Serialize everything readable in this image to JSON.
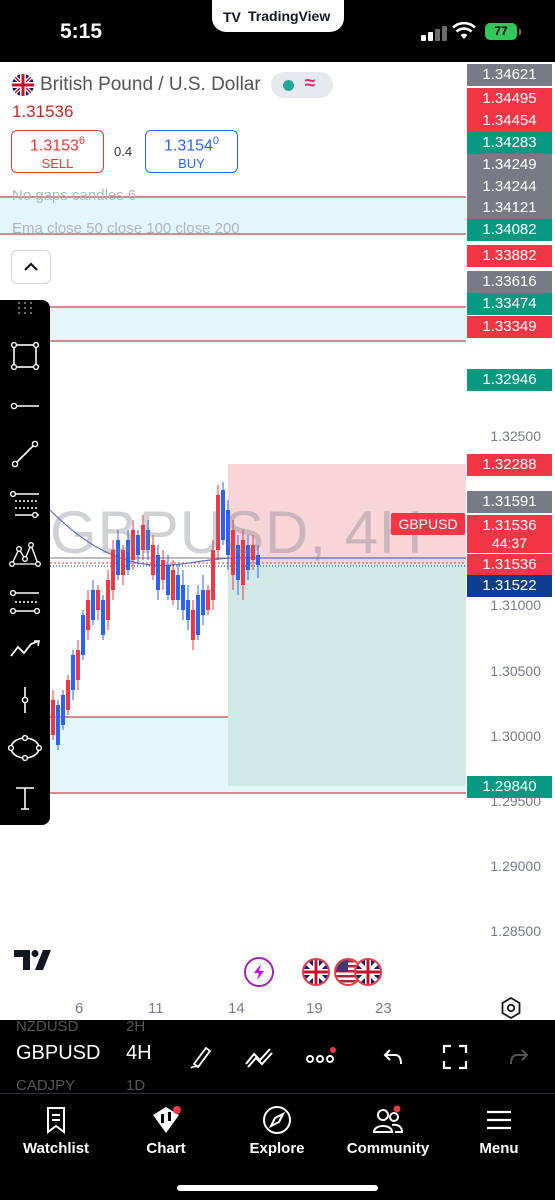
{
  "status_bar": {
    "time": "5:15",
    "app_pill": "TradingView",
    "battery": "77"
  },
  "symbol": {
    "name": "British Pound / U.S. Dollar",
    "last_price": "1.31536",
    "sell_price_main": "1.3153",
    "sell_price_sup": "6",
    "sell_label": "SELL",
    "spread": "0.4",
    "buy_price_main": "1.3154",
    "buy_price_sup": "0",
    "buy_label": "BUY"
  },
  "indicators": [
    "No gaps candles 6",
    "Ema close 50 close 100 close 200"
  ],
  "watermark": "GBPUSD, 4H",
  "price_axis": [
    "1.32500",
    "1.31000",
    "1.30500",
    "1.30000",
    "1.29500",
    "1.29000",
    "1.28500"
  ],
  "price_tags": [
    {
      "text": "1.34621",
      "color": "gray"
    },
    {
      "text": "1.34495",
      "color": "red"
    },
    {
      "text": "1.34454",
      "color": "red"
    },
    {
      "text": "1.34283",
      "color": "green"
    },
    {
      "text": "1.34249",
      "color": "gray"
    },
    {
      "text": "1.34244",
      "color": "gray"
    },
    {
      "text": "1.34121",
      "color": "gray"
    },
    {
      "text": "1.34082",
      "color": "green"
    },
    {
      "text": "1.33882",
      "color": "red"
    },
    {
      "text": "1.33616",
      "color": "gray"
    },
    {
      "text": "1.33474",
      "color": "green"
    },
    {
      "text": "1.33349",
      "color": "red"
    },
    {
      "text": "1.32946",
      "color": "green"
    },
    {
      "text": "1.32288",
      "color": "red"
    },
    {
      "text": "1.31591",
      "color": "gray"
    },
    {
      "text": "1.31536",
      "color": "red"
    },
    {
      "text": "1.31536",
      "color": "red"
    },
    {
      "text": "1.31522",
      "color": "blue"
    },
    {
      "text": "1.29840",
      "color": "green"
    }
  ],
  "symbol_badge": "GBPUSD",
  "countdown": "44:37",
  "time_axis": [
    "6",
    "11",
    "14",
    "19",
    "23"
  ],
  "chart_toolbar": {
    "symbol": "GBPUSD",
    "interval": "4H",
    "ghost_above_symbol": "NZDUSD",
    "ghost_above_interval": "2H",
    "ghost_below_symbol": "CADJPY",
    "ghost_below_interval": "1D"
  },
  "tabs": [
    {
      "label": "Watchlist",
      "icon": "bookmark-icon"
    },
    {
      "label": "Chart",
      "icon": "chart-icon"
    },
    {
      "label": "Explore",
      "icon": "compass-icon"
    },
    {
      "label": "Community",
      "icon": "people-icon"
    },
    {
      "label": "Menu",
      "icon": "hamburger-icon"
    }
  ],
  "colors": {
    "bull": "#2962ff",
    "bear": "#f23645",
    "tag_red": "#f23645",
    "tag_green": "#089981",
    "tag_gray": "#787b86",
    "tag_blue": "#0b3d91"
  }
}
